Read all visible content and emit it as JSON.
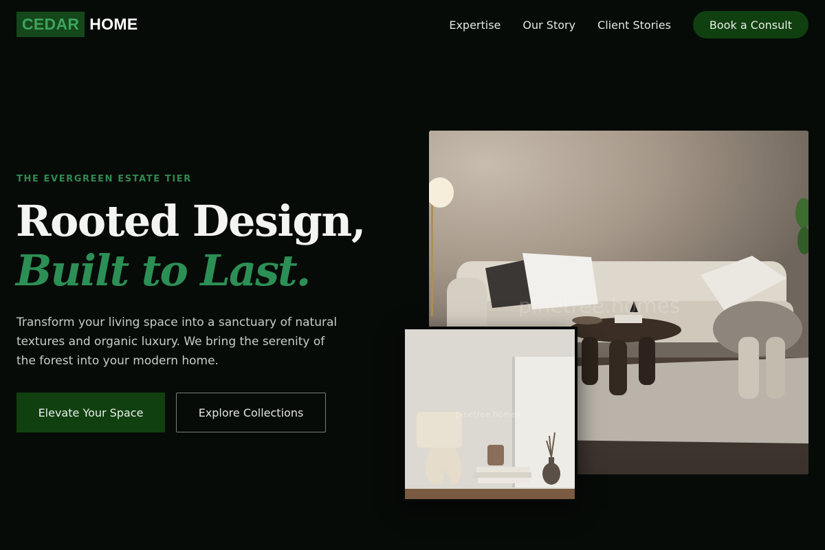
{
  "brand": {
    "name_part1": "CEDAR",
    "name_part2": "HOME"
  },
  "nav": {
    "links": [
      "Expertise",
      "Our Story",
      "Client Stories"
    ],
    "cta_label": "Book a Consult"
  },
  "hero": {
    "eyebrow": "THE EVERGREEN ESTATE TIER",
    "headline_line1": "Rooted Design,",
    "headline_line2": "Built to Last.",
    "description": "Transform your living space into a sanctuary of natural textures and organic luxury. We bring the serenity of the forest into your modern home.",
    "primary_button": "Elevate Your Space",
    "secondary_button": "Explore Collections"
  },
  "images": {
    "main_watermark": "pinetree.homes",
    "inset_watermark": "pinetree.homes"
  },
  "colors": {
    "background": "#070b08",
    "brand_green": "#10400f",
    "accent_green": "#2c8f55"
  }
}
